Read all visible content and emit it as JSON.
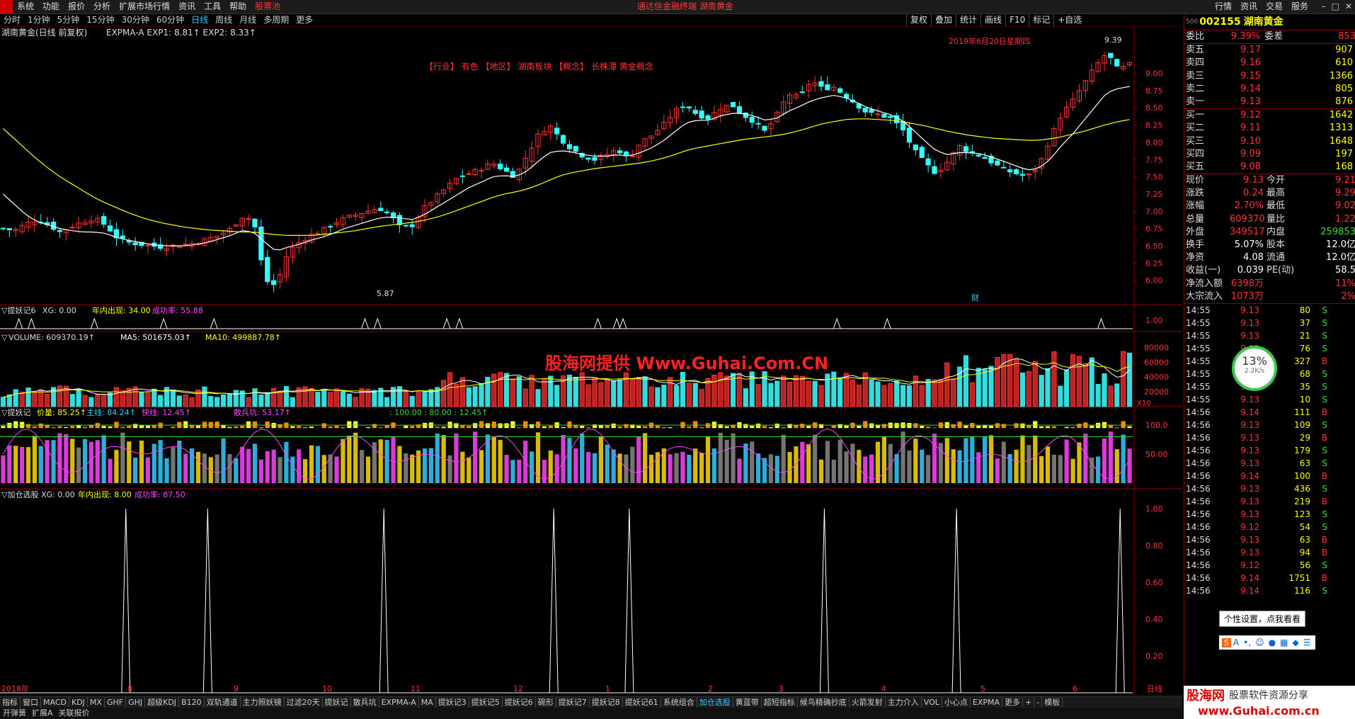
{
  "window": {
    "menu": [
      "系统",
      "功能",
      "报价",
      "分析",
      "扩展市场行情",
      "资讯",
      "工具",
      "帮助",
      "股票池"
    ],
    "title": "通达信金融终端 湖南黄金",
    "right_menu": [
      "行情",
      "资讯",
      "交易",
      "服务"
    ],
    "periods": [
      "分时",
      "1分钟",
      "5分钟",
      "15分钟",
      "30分钟",
      "60分钟",
      "日线",
      "周线",
      "月线",
      "多周期",
      "更多"
    ],
    "active_period": "日线",
    "tools": [
      "复权",
      "叠加",
      "统计",
      "画线",
      "F10",
      "标记",
      "+自选"
    ]
  },
  "chart_data": [
    {
      "type": "candlestick",
      "title": "湖南黄金(日线 前复权)",
      "indicator_line": "EXPMA-A EXP1: 8.81↑ EXP2: 8.33↑",
      "y_ticks": [
        "9.00",
        "8.75",
        "8.50",
        "8.25",
        "8.00",
        "7.75",
        "7.50",
        "7.25",
        "7.00",
        "6.75",
        "6.50",
        "6.25",
        "6.00"
      ],
      "ylim": [
        5.75,
        9.55
      ],
      "annotations": [
        "2019年6月20日星期四",
        "【行业】 有色 【地区】 湖南板块 【概念】 长株潭 黄金概念",
        "9.39",
        "5.87",
        "财"
      ],
      "x_labels": [
        "2018年",
        "8",
        "9",
        "10",
        "11",
        "12",
        "1",
        "2",
        "3",
        "4",
        "5",
        "6",
        "日线"
      ],
      "price_path": [
        6.75,
        6.72,
        6.82,
        6.88,
        6.8,
        6.7,
        6.78,
        6.85,
        6.9,
        6.8,
        6.62,
        6.55,
        6.52,
        6.5,
        6.48,
        6.5,
        6.52,
        6.55,
        6.6,
        6.65,
        6.75,
        6.92,
        6.88,
        6.0,
        5.92,
        6.4,
        6.55,
        6.65,
        6.72,
        6.82,
        6.9,
        6.95,
        7.0,
        7.05,
        6.95,
        6.75,
        6.8,
        7.05,
        7.2,
        7.35,
        7.5,
        7.55,
        7.62,
        7.7,
        7.6,
        7.5,
        7.8,
        8.1,
        8.25,
        8.05,
        7.9,
        7.8,
        7.75,
        7.82,
        7.9,
        7.75,
        8.0,
        8.1,
        8.25,
        8.45,
        8.55,
        8.4,
        8.35,
        8.5,
        8.55,
        8.4,
        8.3,
        8.15,
        8.4,
        8.7,
        8.65,
        8.9,
        8.78,
        8.8,
        8.68,
        8.55,
        8.42,
        8.4,
        8.35,
        8.2,
        7.9,
        7.7,
        7.55,
        7.72,
        7.95,
        7.85,
        7.8,
        7.7,
        7.6,
        7.55,
        7.5,
        7.65,
        8.05,
        8.4,
        8.6,
        8.85,
        9.1,
        9.3,
        9.05,
        9.13
      ],
      "ma1_path": [
        7.25,
        7.1,
        6.95,
        6.85,
        6.8,
        6.75,
        6.72,
        6.7,
        6.7,
        6.68,
        6.62,
        6.58,
        6.55,
        6.52,
        6.5,
        6.5,
        6.5,
        6.52,
        6.55,
        6.6,
        6.65,
        6.72,
        6.7,
        6.55,
        6.42,
        6.48,
        6.52,
        6.58,
        6.62,
        6.68,
        6.75,
        6.8,
        6.85,
        6.9,
        6.92,
        6.9,
        6.88,
        6.95,
        7.05,
        7.15,
        7.25,
        7.35,
        7.42,
        7.5,
        7.52,
        7.5,
        7.58,
        7.72,
        7.85,
        7.88,
        7.86,
        7.82,
        7.8,
        7.8,
        7.82,
        7.8,
        7.85,
        7.92,
        8.02,
        8.15,
        8.28,
        8.32,
        8.32,
        8.38,
        8.42,
        8.42,
        8.38,
        8.32,
        8.35,
        8.45,
        8.52,
        8.6,
        8.65,
        8.68,
        8.65,
        8.58,
        8.5,
        8.45,
        8.4,
        8.32,
        8.18,
        8.02,
        7.88,
        7.82,
        7.85,
        7.85,
        7.83,
        7.78,
        7.72,
        7.66,
        7.6,
        7.62,
        7.75,
        7.95,
        8.12,
        8.32,
        8.52,
        8.72,
        8.78,
        8.81
      ],
      "ma2_path": [
        8.2,
        8.05,
        7.9,
        7.75,
        7.62,
        7.5,
        7.4,
        7.3,
        7.2,
        7.12,
        7.05,
        6.98,
        6.92,
        6.87,
        6.83,
        6.8,
        6.77,
        6.75,
        6.73,
        6.72,
        6.71,
        6.7,
        6.7,
        6.68,
        6.66,
        6.65,
        6.65,
        6.65,
        6.66,
        6.68,
        6.7,
        6.72,
        6.75,
        6.78,
        6.8,
        6.82,
        6.84,
        6.87,
        6.91,
        6.96,
        7.02,
        7.08,
        7.14,
        7.2,
        7.25,
        7.28,
        7.32,
        7.38,
        7.45,
        7.52,
        7.56,
        7.59,
        7.62,
        7.64,
        7.66,
        7.68,
        7.7,
        7.73,
        7.77,
        7.82,
        7.88,
        7.92,
        7.95,
        7.98,
        8.01,
        8.04,
        8.06,
        8.08,
        8.1,
        8.13,
        8.17,
        8.22,
        8.27,
        8.3,
        8.33,
        8.34,
        8.34,
        8.33,
        8.32,
        8.3,
        8.27,
        8.24,
        8.2,
        8.16,
        8.13,
        8.1,
        8.08,
        8.06,
        8.05,
        8.04,
        8.03,
        8.03,
        8.05,
        8.08,
        8.12,
        8.16,
        8.21,
        8.26,
        8.3,
        8.33
      ]
    },
    {
      "type": "indicator",
      "title": "提妖记6",
      "legend": [
        "XG: 0.00",
        "年内出现: 34.00",
        "成功率: 55.88"
      ],
      "y_ticks": [
        "1.00"
      ],
      "spikes_at": [
        3,
        5,
        15,
        26,
        34,
        58,
        60,
        71,
        73,
        95,
        98,
        99,
        133,
        141,
        175
      ]
    },
    {
      "type": "bar",
      "title": "VOLUME",
      "legend": [
        "VOLUME: 609370.19↑",
        "MA5: 501675.03↑",
        "MA10: 499887.78↑"
      ],
      "y_ticks": [
        "80000",
        "60000",
        "40000",
        "20000"
      ],
      "unit": "X10"
    },
    {
      "type": "indicator",
      "title": "提妖记",
      "legend": [
        "价量: 85.25↑",
        "主线: 84.24↑",
        "快线: 12.45↑",
        "散兵坑: 53.17↑",
        ": 100.00 : 80.00 : 12.45↑"
      ],
      "y_ticks": [
        "100.0",
        "50.00"
      ]
    },
    {
      "type": "indicator",
      "title": "加仓选股",
      "legend": [
        "XG: 0.00",
        "年内出现: 8.00",
        "成功率: 87.50"
      ],
      "y_ticks": [
        "1.00",
        "0.80",
        "0.60",
        "0.40",
        "0.20"
      ],
      "spikes_at": [
        20,
        33,
        61,
        88,
        100,
        131,
        152,
        178
      ]
    }
  ],
  "quote": {
    "code": "002155",
    "name": "湖南黄金",
    "weibi": {
      "label": "委比",
      "value": "9.39%",
      "label2": "委差",
      "value2": "853"
    },
    "asks": [
      {
        "label": "卖五",
        "price": "9.17",
        "vol": "907"
      },
      {
        "label": "卖四",
        "price": "9.16",
        "vol": "610"
      },
      {
        "label": "卖三",
        "price": "9.15",
        "vol": "1366"
      },
      {
        "label": "卖二",
        "price": "9.14",
        "vol": "805"
      },
      {
        "label": "卖一",
        "price": "9.13",
        "vol": "876"
      }
    ],
    "bids": [
      {
        "label": "买一",
        "price": "9.12",
        "vol": "1642"
      },
      {
        "label": "买二",
        "price": "9.11",
        "vol": "1313"
      },
      {
        "label": "买三",
        "price": "9.10",
        "vol": "1648"
      },
      {
        "label": "买四",
        "price": "9.09",
        "vol": "197"
      },
      {
        "label": "买五",
        "price": "9.08",
        "vol": "168"
      }
    ],
    "stats": [
      {
        "l1": "现价",
        "v1": "9.13",
        "l2": "今开",
        "v2": "9.21"
      },
      {
        "l1": "涨跌",
        "v1": "0.24",
        "l2": "最高",
        "v2": "9.29"
      },
      {
        "l1": "涨幅",
        "v1": "2.70%",
        "l2": "最低",
        "v2": "9.02"
      },
      {
        "l1": "总量",
        "v1": "609370",
        "l2": "量比",
        "v2": "1.22"
      },
      {
        "l1": "外盘",
        "v1": "349517",
        "l2": "内盘",
        "v2": "259853"
      },
      {
        "l1": "换手",
        "v1": "5.07%",
        "l2": "股本",
        "v2": "12.0亿"
      },
      {
        "l1": "净资",
        "v1": "4.08",
        "l2": "流通",
        "v2": "12.0亿"
      },
      {
        "l1": "收益(一)",
        "v1": "0.039",
        "l2": "PE(动)",
        "v2": "58.5"
      },
      {
        "l1": "净流入额",
        "v1": "6398万",
        "l2": "",
        "v2": "11%"
      },
      {
        "l1": "大宗流入",
        "v1": "1073万",
        "l2": "",
        "v2": "2%"
      }
    ],
    "ticks": [
      {
        "t": "14:55",
        "p": "9.13",
        "v": "80",
        "d": "S"
      },
      {
        "t": "14:55",
        "p": "9.13",
        "v": "37",
        "d": "S"
      },
      {
        "t": "14:55",
        "p": "9.13",
        "v": "21",
        "d": "S"
      },
      {
        "t": "14:55",
        "p": "9.13",
        "v": "76",
        "d": "S"
      },
      {
        "t": "14:55",
        "p": "9.13",
        "v": "327",
        "d": "B"
      },
      {
        "t": "14:55",
        "p": "9.13",
        "v": "68",
        "d": "S"
      },
      {
        "t": "14:55",
        "p": "9.13",
        "v": "35",
        "d": "S"
      },
      {
        "t": "14:55",
        "p": "9.13",
        "v": "10",
        "d": "S"
      },
      {
        "t": "14:56",
        "p": "9.14",
        "v": "111",
        "d": "B"
      },
      {
        "t": "14:56",
        "p": "9.13",
        "v": "109",
        "d": "S"
      },
      {
        "t": "14:56",
        "p": "9.13",
        "v": "29",
        "d": "B"
      },
      {
        "t": "14:56",
        "p": "9.13",
        "v": "179",
        "d": "S"
      },
      {
        "t": "14:56",
        "p": "9.13",
        "v": "63",
        "d": "S"
      },
      {
        "t": "14:56",
        "p": "9.14",
        "v": "100",
        "d": "B"
      },
      {
        "t": "14:56",
        "p": "9.13",
        "v": "436",
        "d": "S"
      },
      {
        "t": "14:56",
        "p": "9.13",
        "v": "219",
        "d": "B"
      },
      {
        "t": "14:56",
        "p": "9.13",
        "v": "123",
        "d": "S"
      },
      {
        "t": "14:56",
        "p": "9.12",
        "v": "54",
        "d": "S"
      },
      {
        "t": "14:56",
        "p": "9.13",
        "v": "63",
        "d": "B"
      },
      {
        "t": "14:56",
        "p": "9.13",
        "v": "94",
        "d": "B"
      },
      {
        "t": "14:56",
        "p": "9.12",
        "v": "56",
        "d": "S"
      },
      {
        "t": "14:56",
        "p": "9.14",
        "v": "1751",
        "d": "B"
      },
      {
        "t": "14:56",
        "p": "9.14",
        "v": "116",
        "d": "S"
      }
    ],
    "speed": {
      "pct": "13%",
      "rate": "2.2K/s"
    },
    "tooltip": "个性设置，点我看看"
  },
  "tabs": [
    "指标",
    "窗口",
    "MACD",
    "KDJ",
    "MX",
    "GHF",
    "GHJ",
    "超级KDJ",
    "B120",
    "双轨通道",
    "主力照妖镜",
    "过滤20天",
    "提妖记",
    "散兵坑",
    "EXPMA-A",
    "MA",
    "提妖记3",
    "提妖记5",
    "提妖记6",
    "碗形",
    "提妖记7",
    "提妖记8",
    "提妖记61",
    "系统组合",
    "加仓选股",
    "黄蓝带",
    "超短指标",
    "候鸟精确抄底",
    "火箭发射",
    "主力介入",
    "VOL",
    "小心点",
    "EXPMA",
    "更多",
    "+",
    "-",
    "模板"
  ],
  "active_tab": "加仓选股",
  "subtabs": [
    "开弹簧",
    "扩展A",
    "关联报价"
  ],
  "watermark": "股海网提供 Www.Guhai.Com.CN",
  "brand": {
    "name": "股海网",
    "slogan": "股票软件资源分享",
    "url": "www.Guhai.com.cn"
  }
}
